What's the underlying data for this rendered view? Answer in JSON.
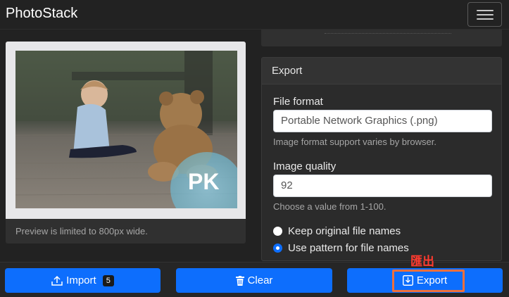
{
  "navbar": {
    "brand": "PhotoStack"
  },
  "preview": {
    "caption": "Preview is limited to 800px wide."
  },
  "export": {
    "title": "Export",
    "file_format": {
      "label": "File format",
      "value": "Portable Network Graphics (.png)",
      "help": "Image format support varies by browser."
    },
    "image_quality": {
      "label": "Image quality",
      "value": "92",
      "help": "Choose a value from 1-100."
    },
    "naming": {
      "option_keep": "Keep original file names",
      "option_pattern": "Use pattern for file names",
      "selected": "Use pattern for file names"
    }
  },
  "footer": {
    "import_label": "Import",
    "import_count": "5",
    "clear_label": "Clear",
    "export_label": "Export"
  },
  "annotation": {
    "text": "匯出"
  },
  "watermark": {
    "text": "PK"
  },
  "colors": {
    "primary": "#0d6efd",
    "highlight": "#ee6f3c",
    "annotation": "#ff3b2f"
  }
}
